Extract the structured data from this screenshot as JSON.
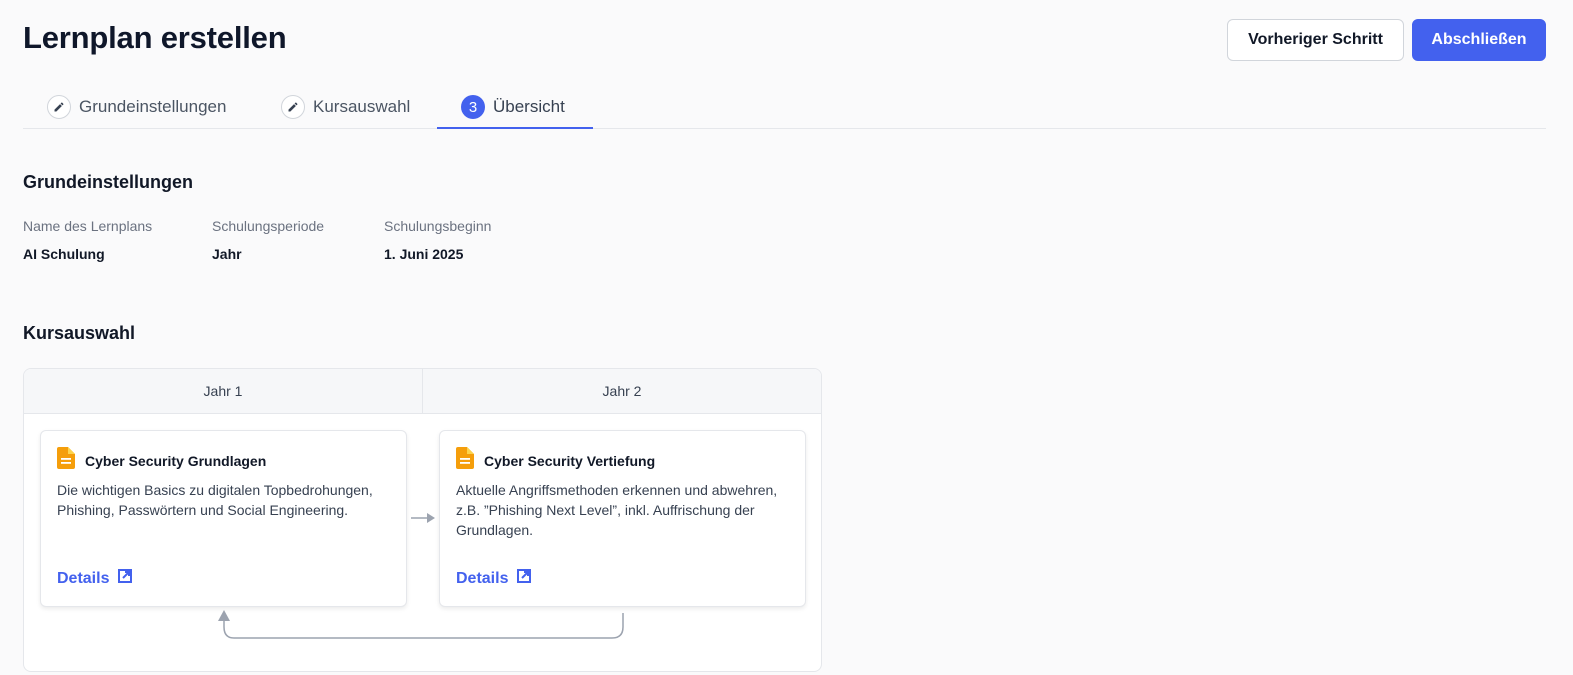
{
  "header": {
    "title": "Lernplan erstellen",
    "prev_label": "Vorheriger Schritt",
    "finish_label": "Abschließen"
  },
  "tabs": [
    {
      "label": "Grundeinstellungen",
      "icon": "pencil-icon"
    },
    {
      "label": "Kursauswahl",
      "icon": "pencil-icon"
    },
    {
      "label": "Übersicht",
      "step": "3",
      "active": true
    }
  ],
  "basics": {
    "title": "Grundeinstellungen",
    "fields": [
      {
        "label": "Name des Lernplans",
        "value": "AI Schulung"
      },
      {
        "label": "Schulungsperiode",
        "value": "Jahr"
      },
      {
        "label": "Schulungsbeginn",
        "value": "1. Juni 2025"
      }
    ]
  },
  "courses": {
    "title": "Kursauswahl",
    "columns": [
      "Jahr 1",
      "Jahr 2"
    ],
    "cards": [
      {
        "title": "Cyber Security Grundlagen",
        "description": "Die wichtigen Basics zu digitalen Topbedrohungen, Phishing, Passwörtern und Social Engineering.",
        "link": "Details",
        "icon": "document-icon"
      },
      {
        "title": "Cyber Security Vertiefung",
        "description": "Aktuelle Angriffsmethoden erkennen und abwehren, z.B. ”Phishing Next Level”, inkl. Auffrischung der Grundlagen.",
        "link": "Details",
        "icon": "document-icon"
      }
    ]
  },
  "colors": {
    "primary": "#4361ee",
    "document_icon": "#f59e0b",
    "connector": "#9ca3af"
  }
}
